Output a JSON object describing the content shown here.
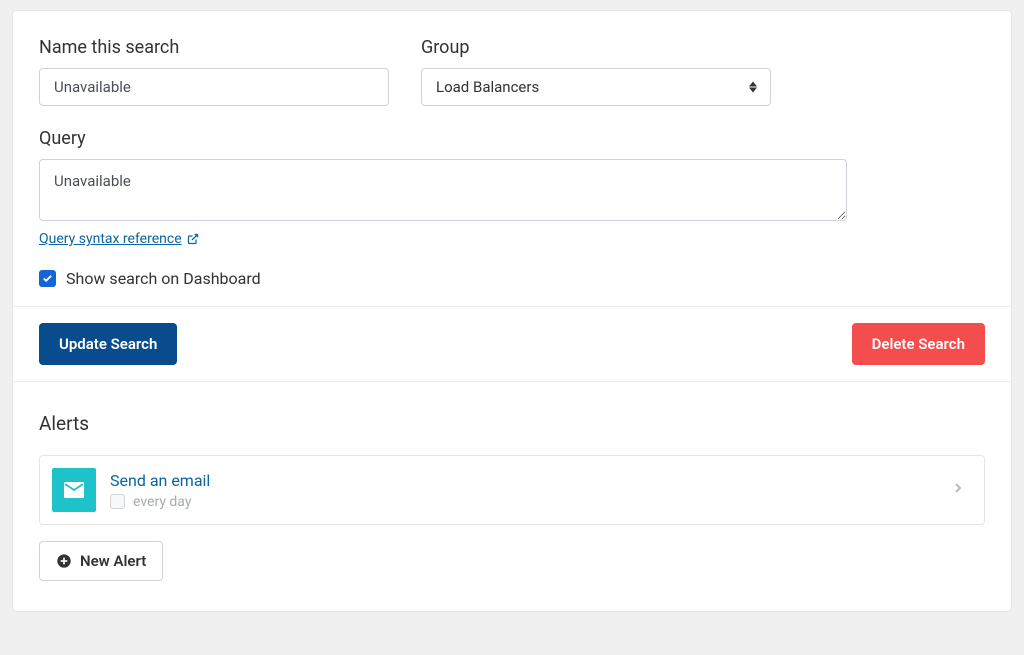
{
  "form": {
    "name_label": "Name this search",
    "name_value": "Unavailable",
    "group_label": "Group",
    "group_value": "Load Balancers",
    "query_label": "Query",
    "query_value": "Unavailable",
    "syntax_link": "Query syntax reference",
    "show_on_dashboard_label": "Show search on Dashboard",
    "show_on_dashboard_checked": true
  },
  "actions": {
    "update_label": "Update Search",
    "delete_label": "Delete Search"
  },
  "alerts": {
    "heading": "Alerts",
    "items": [
      {
        "title": "Send an email",
        "frequency": "every day"
      }
    ],
    "new_alert_label": "New Alert"
  }
}
